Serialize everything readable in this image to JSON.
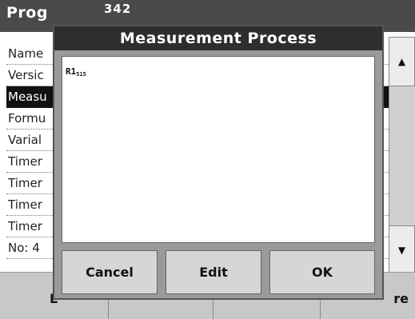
{
  "background": {
    "title": "Prog",
    "title_obscured": "342",
    "list_rows": [
      {
        "label": "Name",
        "selected": false
      },
      {
        "label": "Versic",
        "selected": false
      },
      {
        "label": "Measu",
        "selected": true
      },
      {
        "label": "Formu",
        "selected": false
      },
      {
        "label": "Varial",
        "selected": false
      },
      {
        "label": "Timer",
        "selected": false
      },
      {
        "label": "Timer",
        "selected": false
      },
      {
        "label": "Timer",
        "selected": false
      },
      {
        "label": "Timer",
        "selected": false
      },
      {
        "label": "No: 4",
        "selected": false
      }
    ],
    "row_dots": "......",
    "scroll_up_icon": "▲",
    "scroll_down_icon": "▼",
    "bottom_left_label": "E",
    "bottom_right_label": "re"
  },
  "dialog": {
    "title": "Measurement Process",
    "formula_main": "R1",
    "formula_sub": "515",
    "buttons": {
      "cancel": "Cancel",
      "edit": "Edit",
      "ok": "OK"
    }
  }
}
